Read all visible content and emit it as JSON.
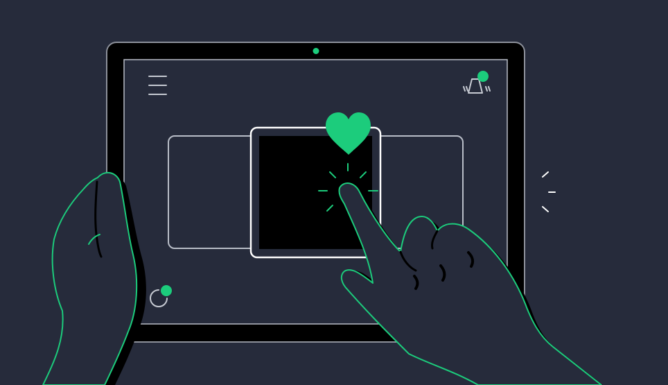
{
  "illustration": {
    "icons": [
      "hamburger-menu-icon",
      "ringing-bell-icon",
      "notification-dot-icon",
      "heart-icon",
      "refresh-icon",
      "tap-spark-icon"
    ]
  },
  "colors": {
    "background": "#262b3b",
    "tablet_body": "#000000",
    "screen": "#262b3b",
    "accent": "#1ccc7c",
    "outline": "#b9bec8",
    "card_border_active": "#ffffff",
    "hand_fill": "#262b3b",
    "hand_shadow": "#000000",
    "hand_outline": "#1ccc7c"
  }
}
